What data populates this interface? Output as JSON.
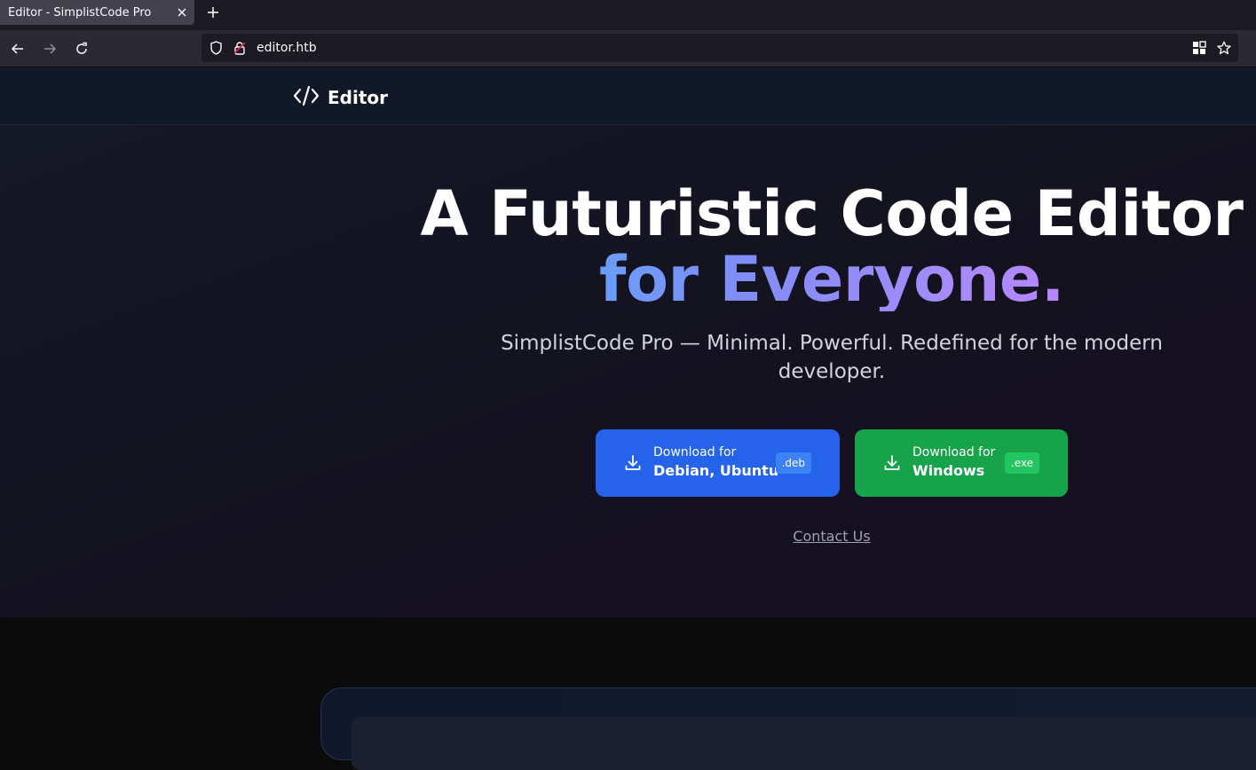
{
  "browser": {
    "tab_title": "Editor - SimplistCode Pro",
    "url": "editor.htb"
  },
  "site": {
    "brand": "Editor",
    "headline_line1": "A Futuristic Code Editor",
    "headline_line2": "for Everyone.",
    "subtitle": "SimplistCode Pro — Minimal. Powerful. Redefined for the modern developer.",
    "buttons": [
      {
        "small": "Download for",
        "big": "Debian, Ubuntu",
        "badge": ".deb",
        "color": "#2563eb"
      },
      {
        "small": "Download for",
        "big": "Windows",
        "badge": ".exe",
        "color": "#16a34a"
      }
    ],
    "contact_link": "Contact Us"
  },
  "icons": {
    "back": "arrow-left-icon",
    "forward": "arrow-right-icon",
    "reload": "reload-icon",
    "shield": "shield-icon",
    "insecure_lock": "insecure-lock-icon",
    "extensions": "grid-icon",
    "bookmark": "star-icon",
    "brand": "code-brackets-icon",
    "download": "download-icon"
  }
}
